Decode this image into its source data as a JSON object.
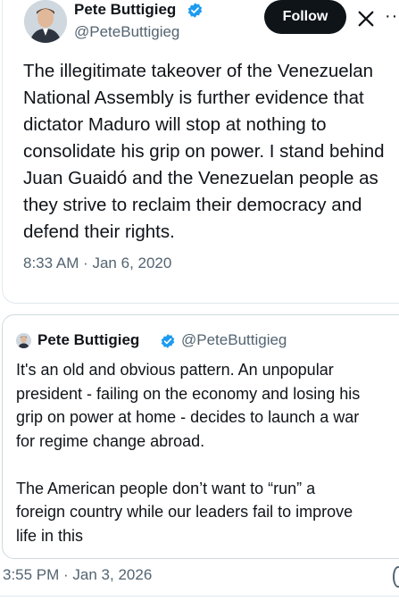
{
  "tweet": {
    "author_name": "Pete Buttigieg",
    "author_handle": "@PeteButtigieg",
    "follow_label": "Follow",
    "more_label": "···",
    "text": "The illegitimate takeover of the Venezuelan\nNational Assembly is further evidence that\ndictator Maduro will stop at nothing to\nconsolidate his grip on power. I stand behind\nJuan Guaidó and the Venezuelan people as\nthey strive to reclaim their democracy and\ndefend their rights.",
    "timestamp": "8:33 AM · Jan 6, 2020"
  },
  "quoted_tweet": {
    "author_name": "Pete Buttigieg",
    "author_handle": "@PeteButtigieg",
    "text": "It's an old and obvious pattern. An unpopular\npresident - failing on the economy and losing his\ngrip on power at home - decides to launch a war\nfor regime change abroad.\n\nThe American people don’t want to “run” a\nforeign country while our leaders fail to improve\nlife in this",
    "timestamp": "3:55 PM · Jan 3, 2026"
  },
  "colors": {
    "verified_badge": "#1d9bf0",
    "follow_button_bg": "#0f1419",
    "secondary_text": "#536471",
    "border": "#cfd9de"
  },
  "icons": {
    "verified": "verified-badge-icon",
    "x_logo": "x-logo-icon",
    "more": "more-icon"
  }
}
